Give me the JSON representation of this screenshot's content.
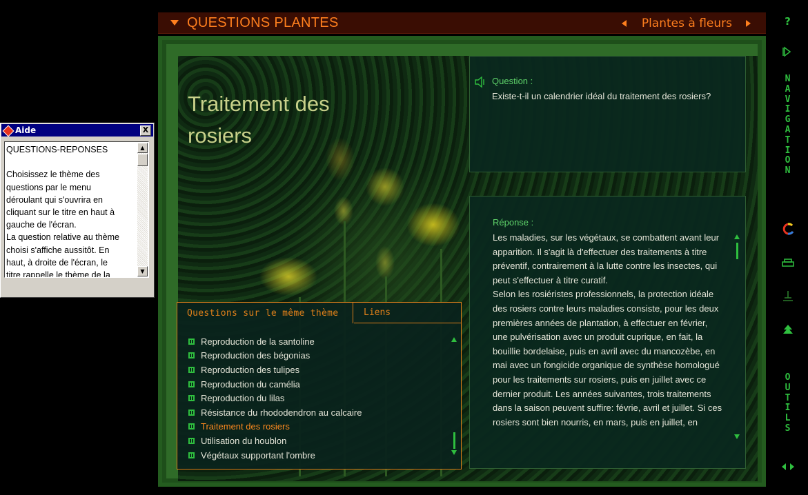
{
  "help_window": {
    "title": "Aide",
    "close_label": "X",
    "text": "QUESTIONS-REPONSES\n\nChoisissez le thème des\nquestions par le menu\ndéroulant qui s'ouvrira en\ncliquant sur le titre en haut à\ngauche de l'écran.\nLa question relative au thème\nchoisi s'affiche aussitôt. En\nhaut, à droite de l'écran, le\ntitre rappelle le thème de la"
  },
  "header": {
    "menu_title": "QUESTIONS PLANTES",
    "category": "Plantes à fleurs"
  },
  "page": {
    "title": "Traitement des rosiers"
  },
  "question": {
    "label": "Question :",
    "text": "Existe-t-il un calendrier idéal du traitement des rosiers?"
  },
  "answer": {
    "label": "Réponse :",
    "text": "Les maladies, sur les végétaux, se combattent avant leur apparition. Il s'agit là d'effectuer des traitements à titre préventif, contrairement à la lutte contre les insectes, qui peut s'effectuer à titre curatif.\nSelon les rosiéristes professionnels, la protection idéale des rosiers contre leurs maladies consiste, pour les deux premières années de plantation, à effectuer en février, une pulvérisation avec un produit cuprique, en fait, la bouillie bordelaise, puis en avril avec du mancozèbe, en mai avec un fongicide organique de synthèse homologué pour les traitements sur rosiers, puis en juillet avec ce dernier produit. Les années suivantes, trois traitements dans la saison peuvent suffire: févrie, avril et juillet. Si ces rosiers sont bien nourris, en mars, puis en juillet, en"
  },
  "related": {
    "tab_same_theme": "Questions sur le même thème",
    "tab_links": "Liens",
    "items": [
      "Reproduction de la santoline",
      "Reproduction des bégonias",
      "Reproduction des tulipes",
      "Reproduction du camélia",
      "Reproduction du lilas",
      "Résistance du rhododendron au calcaire",
      "Traitement des rosiers",
      "Utilisation du houblon",
      "Végétaux supportant l'ombre"
    ],
    "active_index": 6
  },
  "sidebar": {
    "help": "?",
    "navigation": [
      "N",
      "A",
      "V",
      "I",
      "G",
      "A",
      "T",
      "I",
      "O",
      "N"
    ],
    "outils": [
      "O",
      "U",
      "T",
      "I",
      "L",
      "S"
    ]
  },
  "colors": {
    "accent": "#ff7f1e",
    "green": "#2fbf3f",
    "label_green": "#5fd36a"
  }
}
